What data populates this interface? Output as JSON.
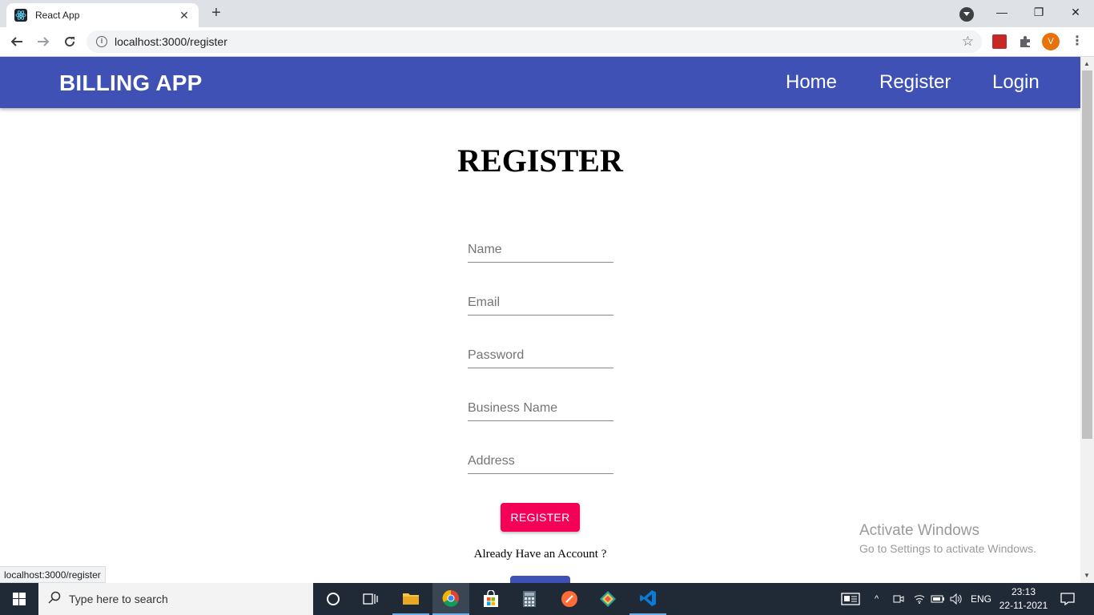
{
  "browser": {
    "tab_title": "React App",
    "url": "localhost:3000/register",
    "profile_initial": "V",
    "status_url": "localhost:3000/register"
  },
  "appbar": {
    "brand": "BILLING APP",
    "nav": [
      "Home",
      "Register",
      "Login"
    ]
  },
  "form": {
    "title": "REGISTER",
    "fields": [
      {
        "placeholder": "Name",
        "value": ""
      },
      {
        "placeholder": "Email",
        "value": ""
      },
      {
        "placeholder": "Password",
        "value": ""
      },
      {
        "placeholder": "Business Name",
        "value": ""
      },
      {
        "placeholder": "Address",
        "value": ""
      }
    ],
    "submit_label": "REGISTER",
    "already_text": "Already Have an Account ?"
  },
  "watermark": {
    "line1": "Activate Windows",
    "line2": "Go to Settings to activate Windows."
  },
  "taskbar": {
    "search_placeholder": "Type here to search",
    "language": "ENG",
    "time": "23:13",
    "date": "22-11-2021"
  },
  "colors": {
    "appbar": "#3f51b5",
    "submit": "#f50057"
  }
}
